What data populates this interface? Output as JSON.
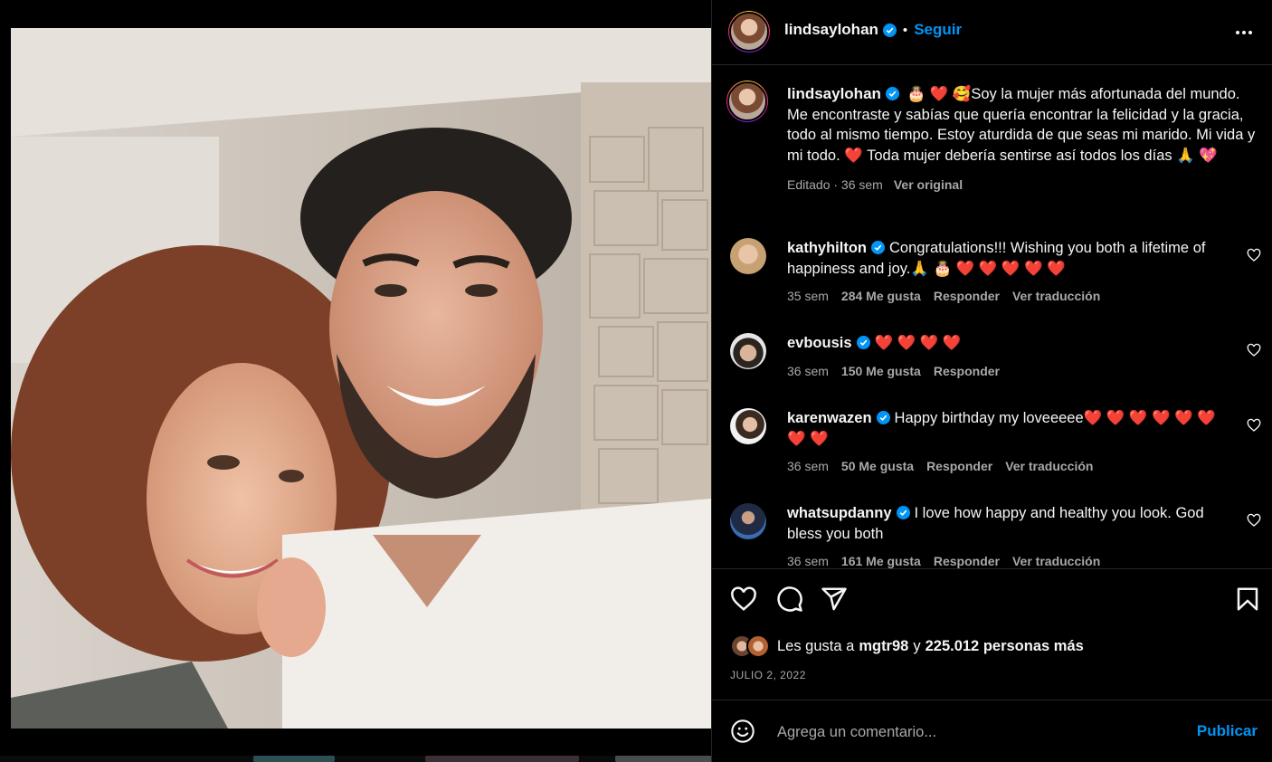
{
  "post": {
    "author": "lindsaylohan",
    "follow_label": "Seguir",
    "separator": "•"
  },
  "caption": {
    "username": "lindsaylohan",
    "text": "🎂 ❤️ 🥰Soy la mujer más afortunada del mundo. Me encontraste y sabías que quería encontrar la felicidad y la gracia, todo al mismo tiempo. Estoy aturdida de que seas mi marido. Mi vida y mi todo. ❤️ Toda mujer debería sentirse así todos los días 🙏 💖",
    "edited": "Editado · 36 sem",
    "translate": "Ver original"
  },
  "comments": [
    {
      "username": "kathyhilton",
      "verified": true,
      "text": "Congratulations!!! Wishing you both a lifetime of happiness and joy.🙏 🎂 ❤️ ❤️ ❤️ ❤️ ❤️",
      "time": "35 sem",
      "likes": "284 Me gusta",
      "reply": "Responder",
      "translate": "Ver traducción"
    },
    {
      "username": "evbousis",
      "verified": true,
      "text": "❤️ ❤️ ❤️ ❤️",
      "time": "36 sem",
      "likes": "150 Me gusta",
      "reply": "Responder",
      "translate": ""
    },
    {
      "username": "karenwazen",
      "verified": true,
      "text": "Happy birthday my loveeeee❤️ ❤️ ❤️ ❤️ ❤️ ❤️ ❤️ ❤️",
      "time": "36 sem",
      "likes": "50 Me gusta",
      "reply": "Responder",
      "translate": "Ver traducción"
    },
    {
      "username": "whatsupdanny",
      "verified": true,
      "text": "I love how happy and healthy you look. God bless you both",
      "time": "36 sem",
      "likes": "161 Me gusta",
      "reply": "Responder",
      "translate": "Ver traducción"
    }
  ],
  "likes": {
    "prefix": "Les gusta a",
    "user": "mgtr98",
    "conj": "y",
    "others": "225.012 personas más"
  },
  "date": "JULIO 2, 2022",
  "add_comment": {
    "placeholder": "Agrega un comentario...",
    "publish_label": "Publicar"
  },
  "colors": {
    "accent": "#0095f6",
    "background": "#000000",
    "muted": "#a8a8a8",
    "heart": "#ff2d4b"
  }
}
